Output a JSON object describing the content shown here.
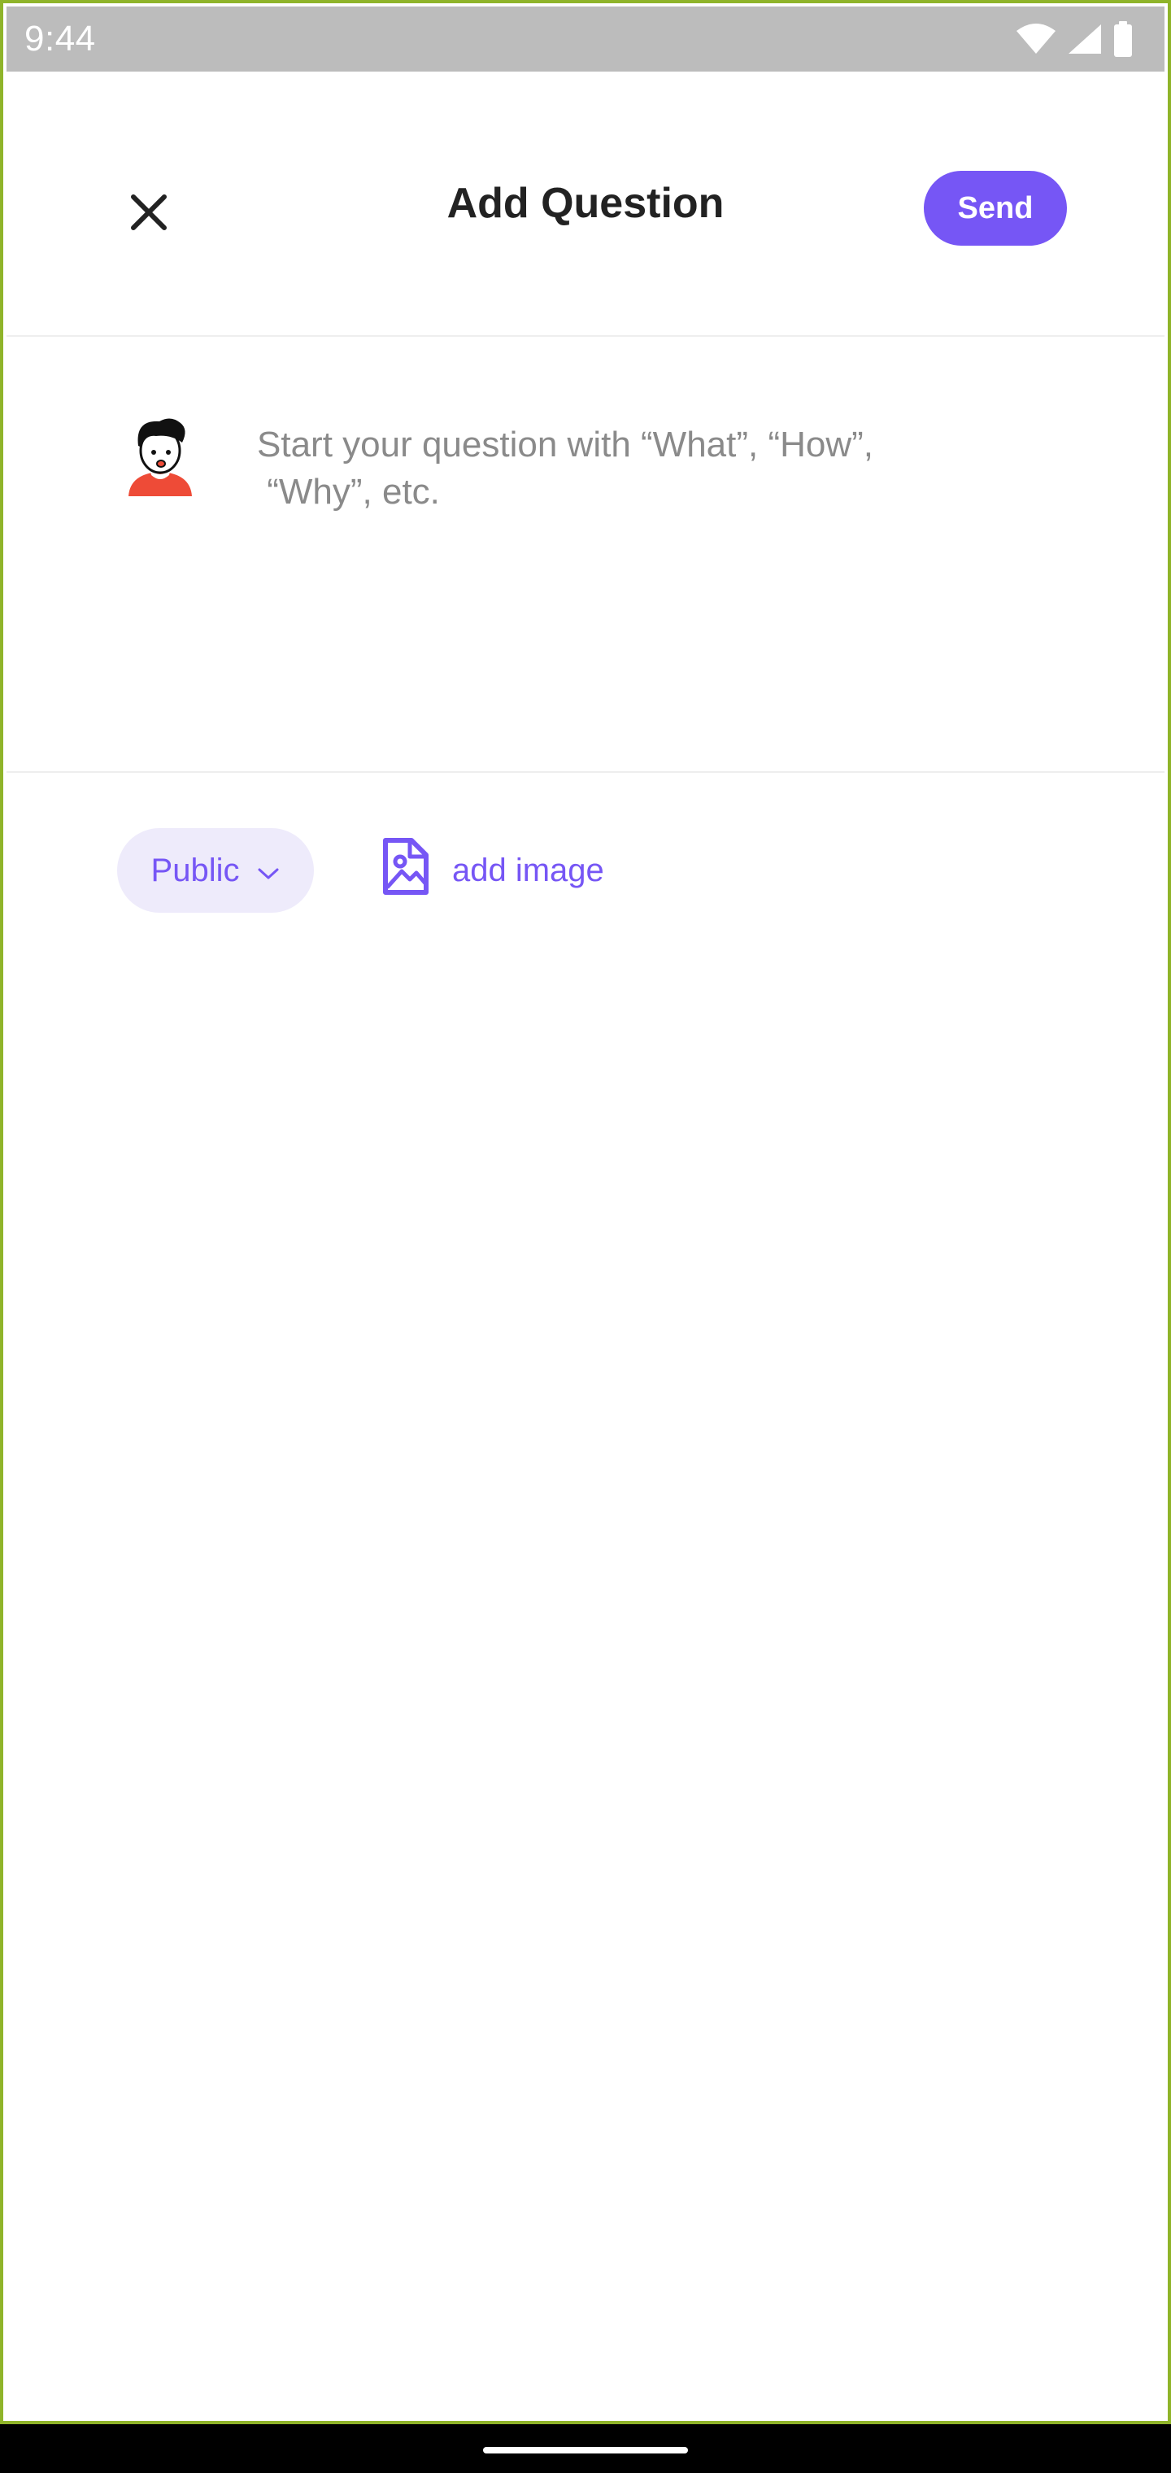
{
  "status_bar": {
    "time": "9:44",
    "icons": [
      "wifi-icon",
      "signal-icon",
      "battery-icon"
    ]
  },
  "header": {
    "title": "Add Question",
    "close_icon": "close-icon",
    "send_label": "Send"
  },
  "composer": {
    "avatar": "user-avatar",
    "placeholder": "Start your question with “What”, “How”,\n “Why”, etc.",
    "value": ""
  },
  "options": {
    "privacy_label": "Public",
    "privacy_icon": "chevron-down-icon",
    "add_image_label": "add image",
    "add_image_icon": "image-file-icon"
  },
  "colors": {
    "accent": "#7656f5",
    "accent_light": "#eeebfb",
    "status_bar": "#bcbcbc",
    "frame_border": "#8fb42a"
  }
}
